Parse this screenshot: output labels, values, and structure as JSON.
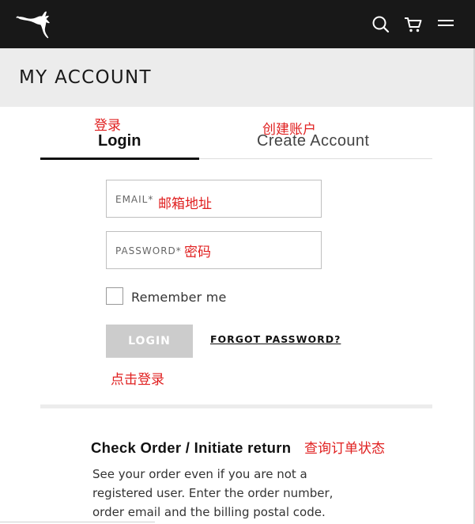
{
  "header": {
    "logo": "puma-cat-logo",
    "icons": [
      "search-icon",
      "cart-icon",
      "menu-icon"
    ],
    "title": "MY ACCOUNT"
  },
  "tabs": {
    "login": "Login",
    "create": "Create Account",
    "active": "login"
  },
  "form": {
    "email_label": "EMAIL*",
    "password_label": "PASSWORD*",
    "remember_label": "Remember me",
    "remember_checked": false,
    "login_button": "LOGIN",
    "forgot_link": "FORGOT PASSWORD?"
  },
  "check_order": {
    "title": "Check Order / Initiate return",
    "body": "See your order even if you are not a registered user. Enter the order number, order email and the billing postal code."
  },
  "annotations": {
    "login_tab": "登录",
    "create_tab": "创建账户",
    "email": "邮箱地址",
    "password": "密码",
    "login_button": "点击登录",
    "check_order": "查询订单状态"
  },
  "colors": {
    "topbar": "#181818",
    "header_band": "#ececec",
    "annotation": "#e02020",
    "button_disabled": "#cccccc"
  }
}
